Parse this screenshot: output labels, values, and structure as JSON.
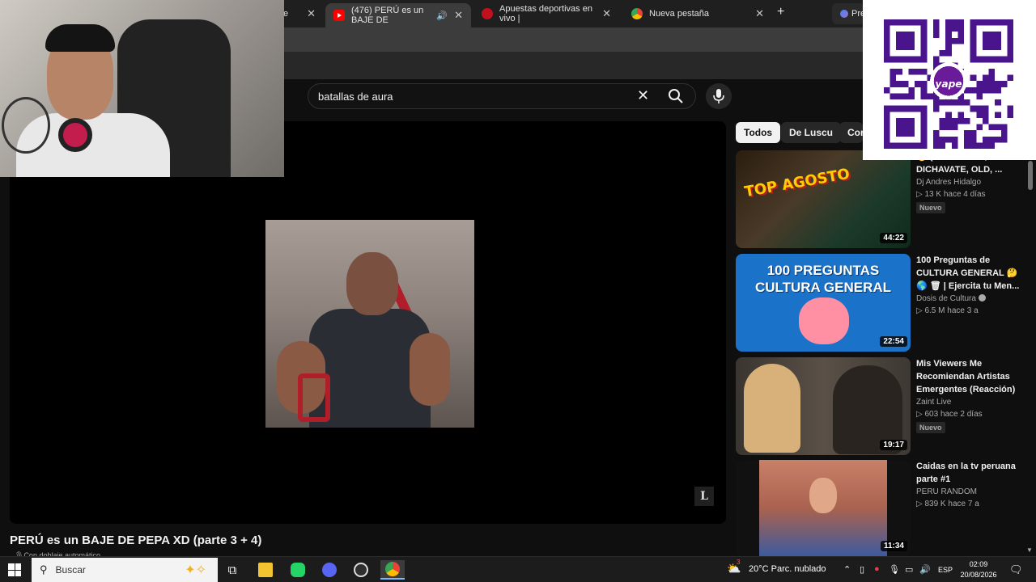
{
  "browser": {
    "tabs": [
      {
        "label": "e",
        "favicon": "partial-tab"
      },
      {
        "label": "(476) PERÚ es un BAJE DE",
        "favicon": "youtube-icon",
        "active": true
      },
      {
        "label": "Apuestas deportivas en vivo |",
        "favicon": "betting-site-icon"
      },
      {
        "label": "Nueva pestaña",
        "favicon": "chrome-icon"
      },
      {
        "label": "Pre",
        "favicon": "gemini-icon"
      }
    ],
    "new_tab_label": "+"
  },
  "youtube": {
    "search": {
      "query": "batallas de aura"
    },
    "video": {
      "title": "PERÚ es un BAJE DE PEPA XD (parte 3 + 4)",
      "subtitle": "Con doblaje automático",
      "corner_badge": "L"
    },
    "chips": [
      "Todos",
      "De Luscu",
      "Con"
    ],
    "recommendations": [
      {
        "title": "🔥 (DE LEJITOS, DICHAVATE, OLD, ...",
        "channel": "Dj Andres Hidalgo",
        "views": "▷ 13 K",
        "age": "hace 4 días",
        "badge": "Nuevo",
        "duration": "44:22",
        "thumb_text": "TOP AGOSTO"
      },
      {
        "title": "100 Preguntas de CULTURA GENERAL 🤔 🌎 🗑 | Ejercita tu Men...",
        "channel": "Dosis de Cultura",
        "views": "▷ 6.5 M",
        "age": "hace 3 a",
        "badge": "",
        "duration": "22:54",
        "thumb_text": "100 PREGUNTAS CULTURA GENERAL"
      },
      {
        "title": "Mis Viewers Me Recomiendan Artistas Emergentes (Reacción)",
        "channel": "Zaint Live",
        "views": "▷ 603",
        "age": "hace 2 días",
        "badge": "Nuevo",
        "duration": "19:17",
        "thumb_text": ""
      },
      {
        "title": "Caidas en la tv peruana parte #1",
        "channel": "PERU RANDOM",
        "views": "▷ 839 K",
        "age": "hace 7 a",
        "badge": "",
        "duration": "11:34",
        "thumb_text": ""
      }
    ]
  },
  "overlay": {
    "qr_brand": "yape",
    "qr_brand_color": "#6a1b9a"
  },
  "taskbar": {
    "search_label": "Buscar",
    "weather": "20°C  Parc. nublado",
    "language": "ESP",
    "time": "02:09",
    "date": "20/08/2026",
    "notification_count": "3"
  },
  "colors": {
    "background": "#0f0f0f",
    "youtube_red": "#ff0000",
    "chip_active": "#f1f1f1"
  }
}
